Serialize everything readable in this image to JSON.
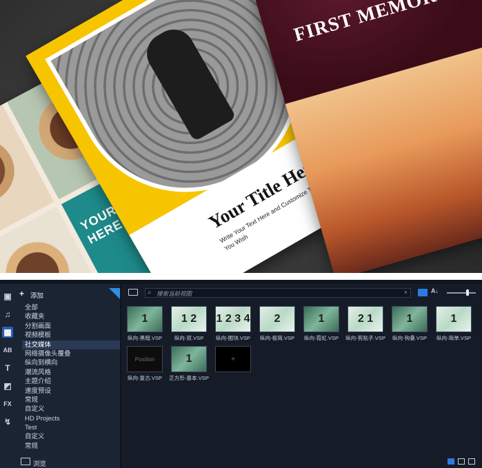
{
  "hero": {
    "collage_text": "YOUR TEXT HERE",
    "spiral_title": "Your Title Here",
    "spiral_subtitle": "Write Your Text Here and Customize This Template as You Wish",
    "memory_title": "FIRST MEMORY"
  },
  "toolbar": {
    "add_label": "添加",
    "browse_label": "浏览"
  },
  "tool_rail": [
    {
      "icon": "media-icon",
      "glyph": "▣"
    },
    {
      "icon": "music-icon",
      "glyph": "♫"
    },
    {
      "icon": "template-icon",
      "glyph": "▦"
    },
    {
      "icon": "transition-icon",
      "glyph": "AB"
    },
    {
      "icon": "title-icon",
      "glyph": "T"
    },
    {
      "icon": "graphics-icon",
      "glyph": "◩"
    },
    {
      "icon": "filter-icon",
      "glyph": "FX"
    },
    {
      "icon": "path-icon",
      "glyph": "↯"
    }
  ],
  "folders": [
    "全部",
    "收藏夹",
    "分割画面",
    "视频模板",
    "社交媒体",
    "网络摄像头覆叠",
    "纵向到横向",
    "潮流风格",
    "主题介绍",
    "速度预设",
    "常规",
    "自定义",
    "HD Projects",
    "Test",
    "自定义",
    "常规"
  ],
  "selected_folder_index": 4,
  "search": {
    "placeholder": "搜索当前视图"
  },
  "thumbnails": [
    {
      "caption": "纵向-黑暗.VSP",
      "glyph": "1",
      "style": "green"
    },
    {
      "caption": "纵向-双.VSP",
      "glyph": "1 2",
      "style": "light"
    },
    {
      "caption": "纵向-图块.VSP",
      "glyph": "1 2 3 4",
      "style": "light"
    },
    {
      "caption": "纵向-极简.VSP",
      "glyph": "2",
      "style": "light"
    },
    {
      "caption": "纵向-霓虹.VSP",
      "glyph": "1",
      "style": "green"
    },
    {
      "caption": "纵向-剪贴子.VSP",
      "glyph": "2 1",
      "style": "light"
    },
    {
      "caption": "纵向-钩叠.VSP",
      "glyph": "1",
      "style": "green"
    },
    {
      "caption": "纵向-简单.VSP",
      "glyph": "1",
      "style": "light"
    },
    {
      "caption": "纵向-复古.VSP",
      "glyph": "Position",
      "style": "dark"
    },
    {
      "caption": "正方形-基本.VSP",
      "glyph": "1",
      "style": "green"
    },
    {
      "caption": "",
      "glyph": "+",
      "style": "empty"
    }
  ]
}
